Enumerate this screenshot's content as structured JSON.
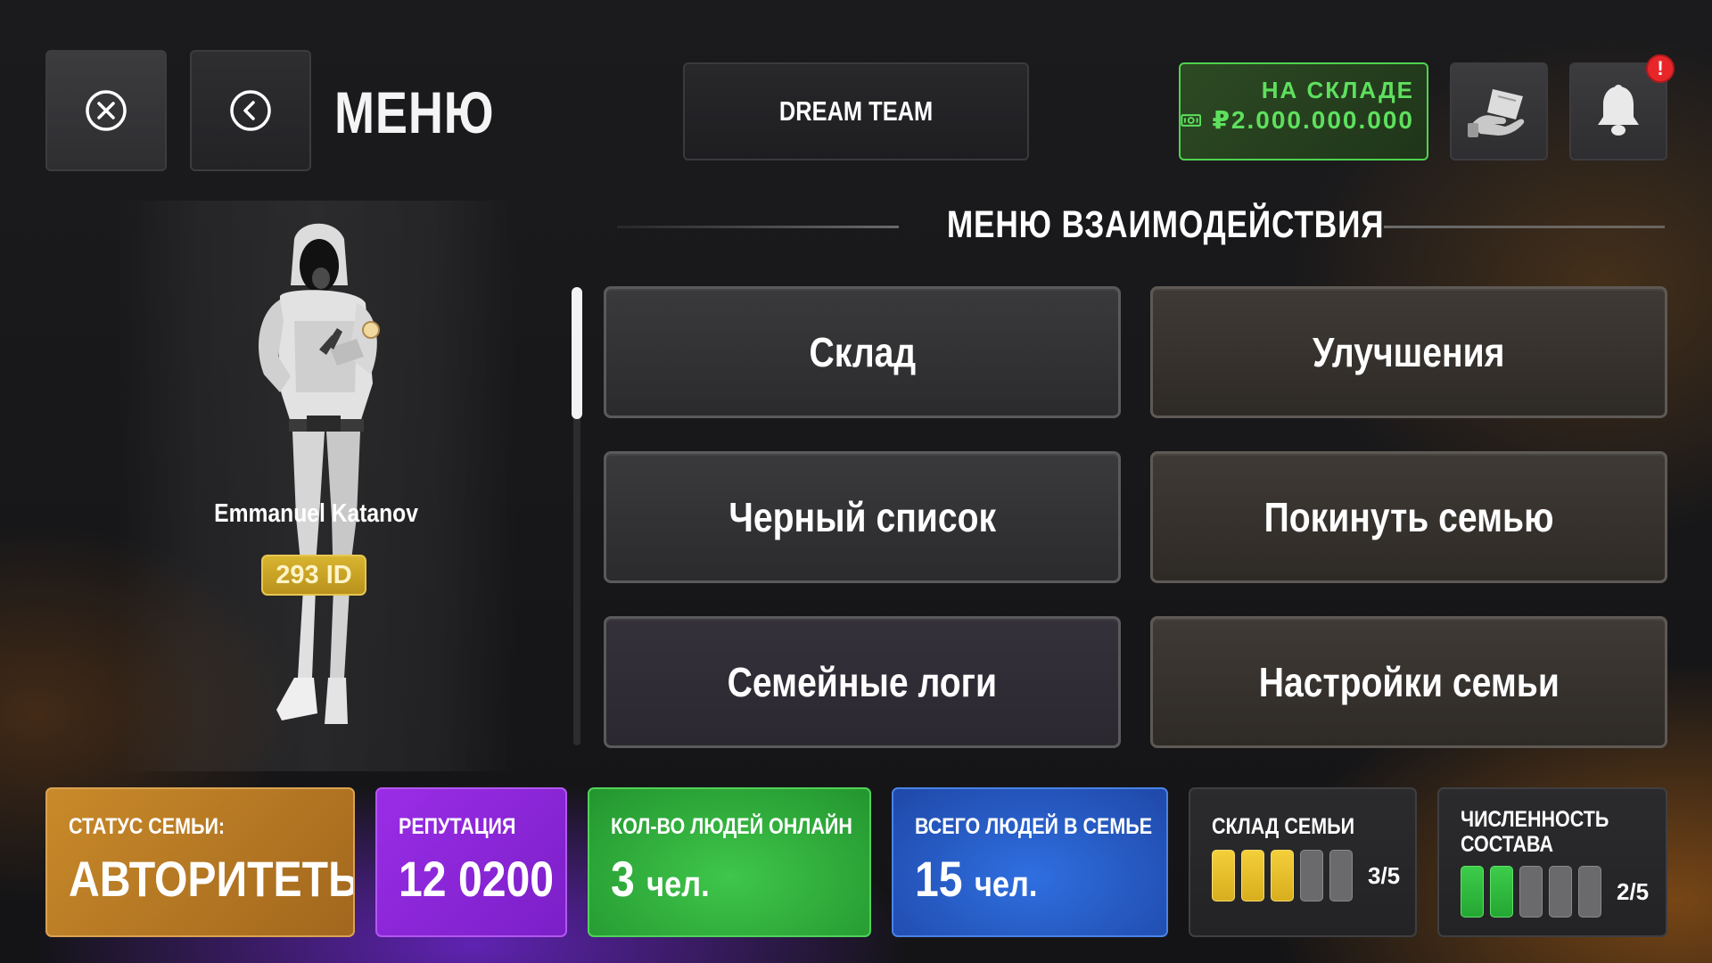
{
  "header": {
    "title": "МЕНЮ",
    "team_tab": "DREAM TEAM",
    "stock": {
      "label": "НА СКЛАДЕ",
      "amount": "₽2.000.000.000"
    },
    "notification_badge": "!"
  },
  "interaction_menu": {
    "title": "МЕНЮ ВЗАИМОДЕЙСТВИЯ",
    "buttons": [
      "Склад",
      "Улучшения",
      "Черный список",
      "Покинуть семью",
      "Семейные логи",
      "Настройки семьи"
    ]
  },
  "character": {
    "name": "Emmanuel Katanov",
    "id": "293 ID"
  },
  "stats": {
    "status": {
      "label": "СТАТУС СЕМЬИ:",
      "value": "АВТОРИТЕТЫ"
    },
    "reputation": {
      "label": "РЕПУТАЦИЯ",
      "value": "12 0200"
    },
    "online": {
      "label": "КОЛ-ВО ЛЮДЕЙ ОНЛАЙН",
      "number": "3",
      "unit": "чел."
    },
    "total": {
      "label": "ВСЕГО ЛЮДЕЙ В СЕМЬЕ",
      "number": "15",
      "unit": "чел."
    },
    "storage": {
      "label": "СКЛАД СЕМЬИ",
      "filled": 3,
      "total": 5,
      "text": "3/5"
    },
    "size": {
      "label_line1": "ЧИСЛЕННОСТЬ",
      "label_line2": "СОСТАВА",
      "filled": 2,
      "total": 5,
      "text": "2/5"
    }
  },
  "colors": {
    "stock_green": "#5ee05e",
    "id_gold": "#d8b430",
    "alert_red": "#e8262a"
  }
}
